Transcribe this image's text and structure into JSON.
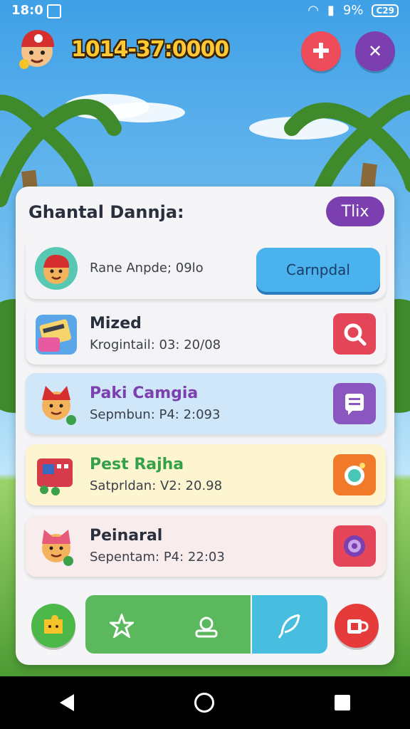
{
  "status_bar": {
    "time": "18:0",
    "signal_text": "9%",
    "battery": "C29"
  },
  "header": {
    "score": "1014-37:0000"
  },
  "panel": {
    "title": "Ghantal Dannja:",
    "tag": "Tlix",
    "first_row": {
      "text": "Rane Anpde; 09lo",
      "button": "Carnpdal"
    },
    "rows": [
      {
        "title": "Mized",
        "subtitle": "Krogintail: 03: 20/08",
        "bg": "#f4f4f6",
        "title_color": "#2a2f3d",
        "action": "search-icon",
        "action_color": "#e54558"
      },
      {
        "title": "Paki Camgia",
        "subtitle": "Sepmbun: P4: 2:093",
        "bg": "#cfe7f8",
        "title_color": "#7b3fb0",
        "action": "chat-icon",
        "action_color": "#8a56c0"
      },
      {
        "title": "Pest Rajha",
        "subtitle": "Satprldan: V2: 20.98",
        "bg": "#fdf5cf",
        "title_color": "#34a04a",
        "action": "camera-icon",
        "action_color": "#f07a2a"
      },
      {
        "title": "Peinaral",
        "subtitle": "Sepentam: P4: 22:03",
        "bg": "#f8ecec",
        "title_color": "#2a2f3d",
        "action": "record-icon",
        "action_color": "#e54558"
      }
    ]
  },
  "colors": {
    "accent_purple": "#7b3fb0",
    "accent_red": "#ee4b5b",
    "cta_blue": "#4ab3ee"
  }
}
